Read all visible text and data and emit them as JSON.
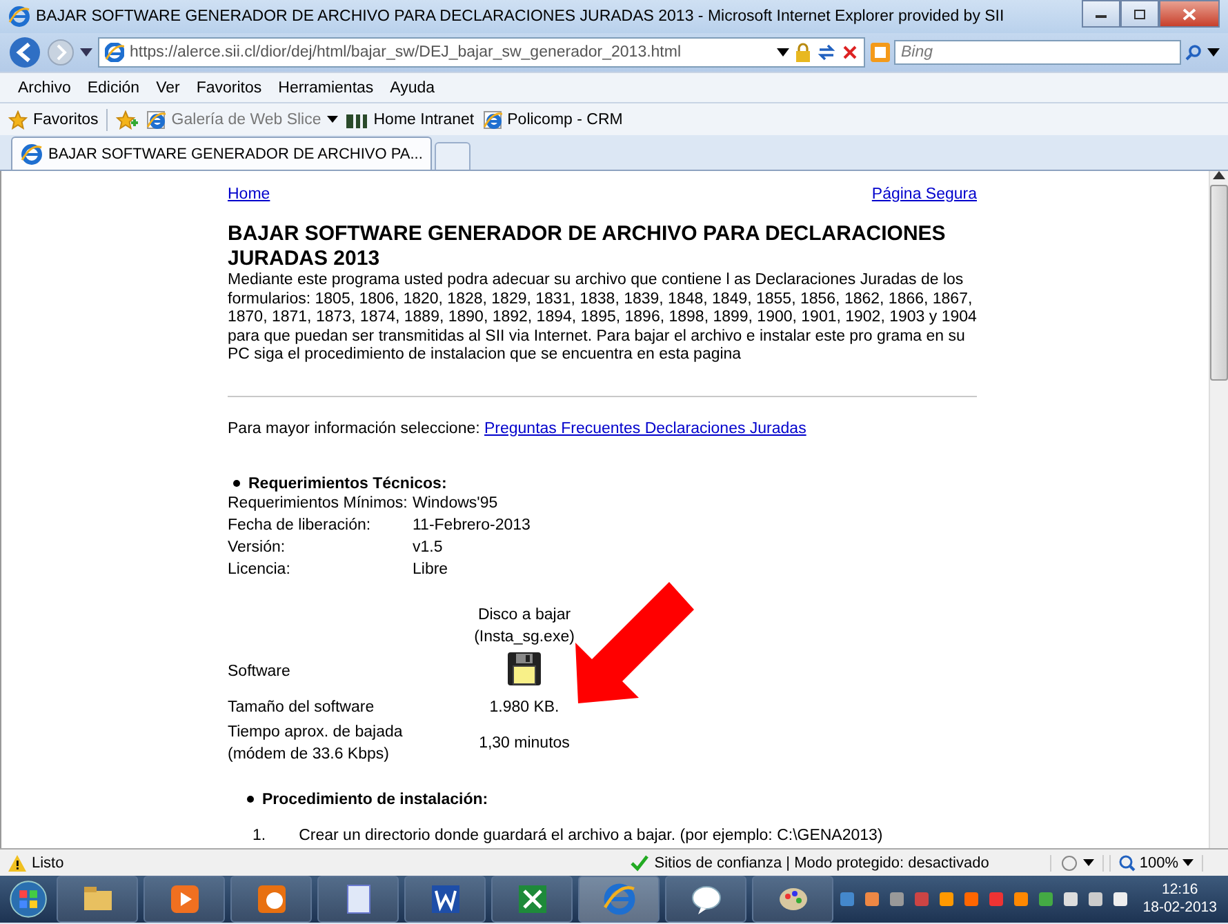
{
  "window": {
    "title": "BAJAR SOFTWARE GENERADOR DE ARCHIVO PARA DECLARACIONES JURADAS 2013 - Microsoft Internet Explorer provided by SII"
  },
  "address_bar": {
    "url": "https://alerce.sii.cl/dior/dej/html/bajar_sw/DEJ_bajar_sw_generador_2013.html",
    "search_placeholder": "Bing"
  },
  "menu": [
    "Archivo",
    "Edición",
    "Ver",
    "Favoritos",
    "Herramientas",
    "Ayuda"
  ],
  "favorites_bar": {
    "label": "Favoritos",
    "items": [
      {
        "label": "Galería de Web Slice",
        "kind": "slice",
        "disabled": true
      },
      {
        "label": "Home Intranet",
        "kind": "sii",
        "disabled": false
      },
      {
        "label": "Policomp - CRM",
        "kind": "ie",
        "disabled": false
      }
    ]
  },
  "tabs": [
    {
      "label": "BAJAR SOFTWARE GENERADOR DE ARCHIVO PA...",
      "selected": true
    }
  ],
  "page": {
    "home_link": "Home",
    "secure_link": "Página Segura",
    "heading": "BAJAR SOFTWARE GENERADOR DE ARCHIVO PARA DECLARACIONES JURADAS 2013",
    "intro": "Mediante este programa usted podra adecuar su archivo que contiene l as Declaraciones Juradas de los formularios: 1805, 1806, 1820, 1828, 1829, 1831, 1838, 1839, 1848, 1849, 1855, 1856, 1862, 1866, 1867, 1870, 1871, 1873, 1874, 1889, 1890, 1892, 1894, 1895, 1896, 1898, 1899, 1900, 1901, 1902, 1903 y 1904 para que puedan ser transmitidas al SII via Internet. Para bajar el archivo e instalar este pro grama en su PC siga el procedimiento de instalacion que se encuentra en esta pagina",
    "more_info": {
      "text": "Para mayor información seleccione:",
      "link": "Preguntas Frecuentes Declaraciones Juradas"
    },
    "requirements": {
      "title": "Requerimientos Técnicos:",
      "rows": [
        {
          "label": "Requerimientos Mínimos:",
          "value": "Windows'95"
        },
        {
          "label": "Fecha de liberación:",
          "value": "11-Febrero-2013"
        },
        {
          "label": "Versión:",
          "value": "v1.5"
        },
        {
          "label": "Licencia:",
          "value": "Libre"
        }
      ]
    },
    "download": {
      "caption": [
        "Disco a bajar",
        "(Insta_sg.exe)"
      ],
      "rows": [
        {
          "label": "Software",
          "kind": "disk"
        },
        {
          "label": "Tamaño del software",
          "kind": "text",
          "value": "1.980 KB."
        },
        {
          "label": "Tiempo aprox. de bajada (módem de 33.6 Kbps)",
          "kind": "text",
          "value": "1,30 minutos"
        }
      ]
    },
    "procedure": {
      "title": "Procedimiento de instalación:",
      "steps": [
        {
          "number": "1.",
          "text": "Crear un directorio donde guardará el archivo a bajar. (por ejemplo: C:\\GENA2013)"
        }
      ]
    }
  },
  "status_bar": {
    "text": "Listo",
    "zone": "Sitios de confianza | Modo protegido: desactivado",
    "zoom": "100%"
  },
  "taskbar": {
    "time": "12:16",
    "date": "18-02-2013"
  }
}
